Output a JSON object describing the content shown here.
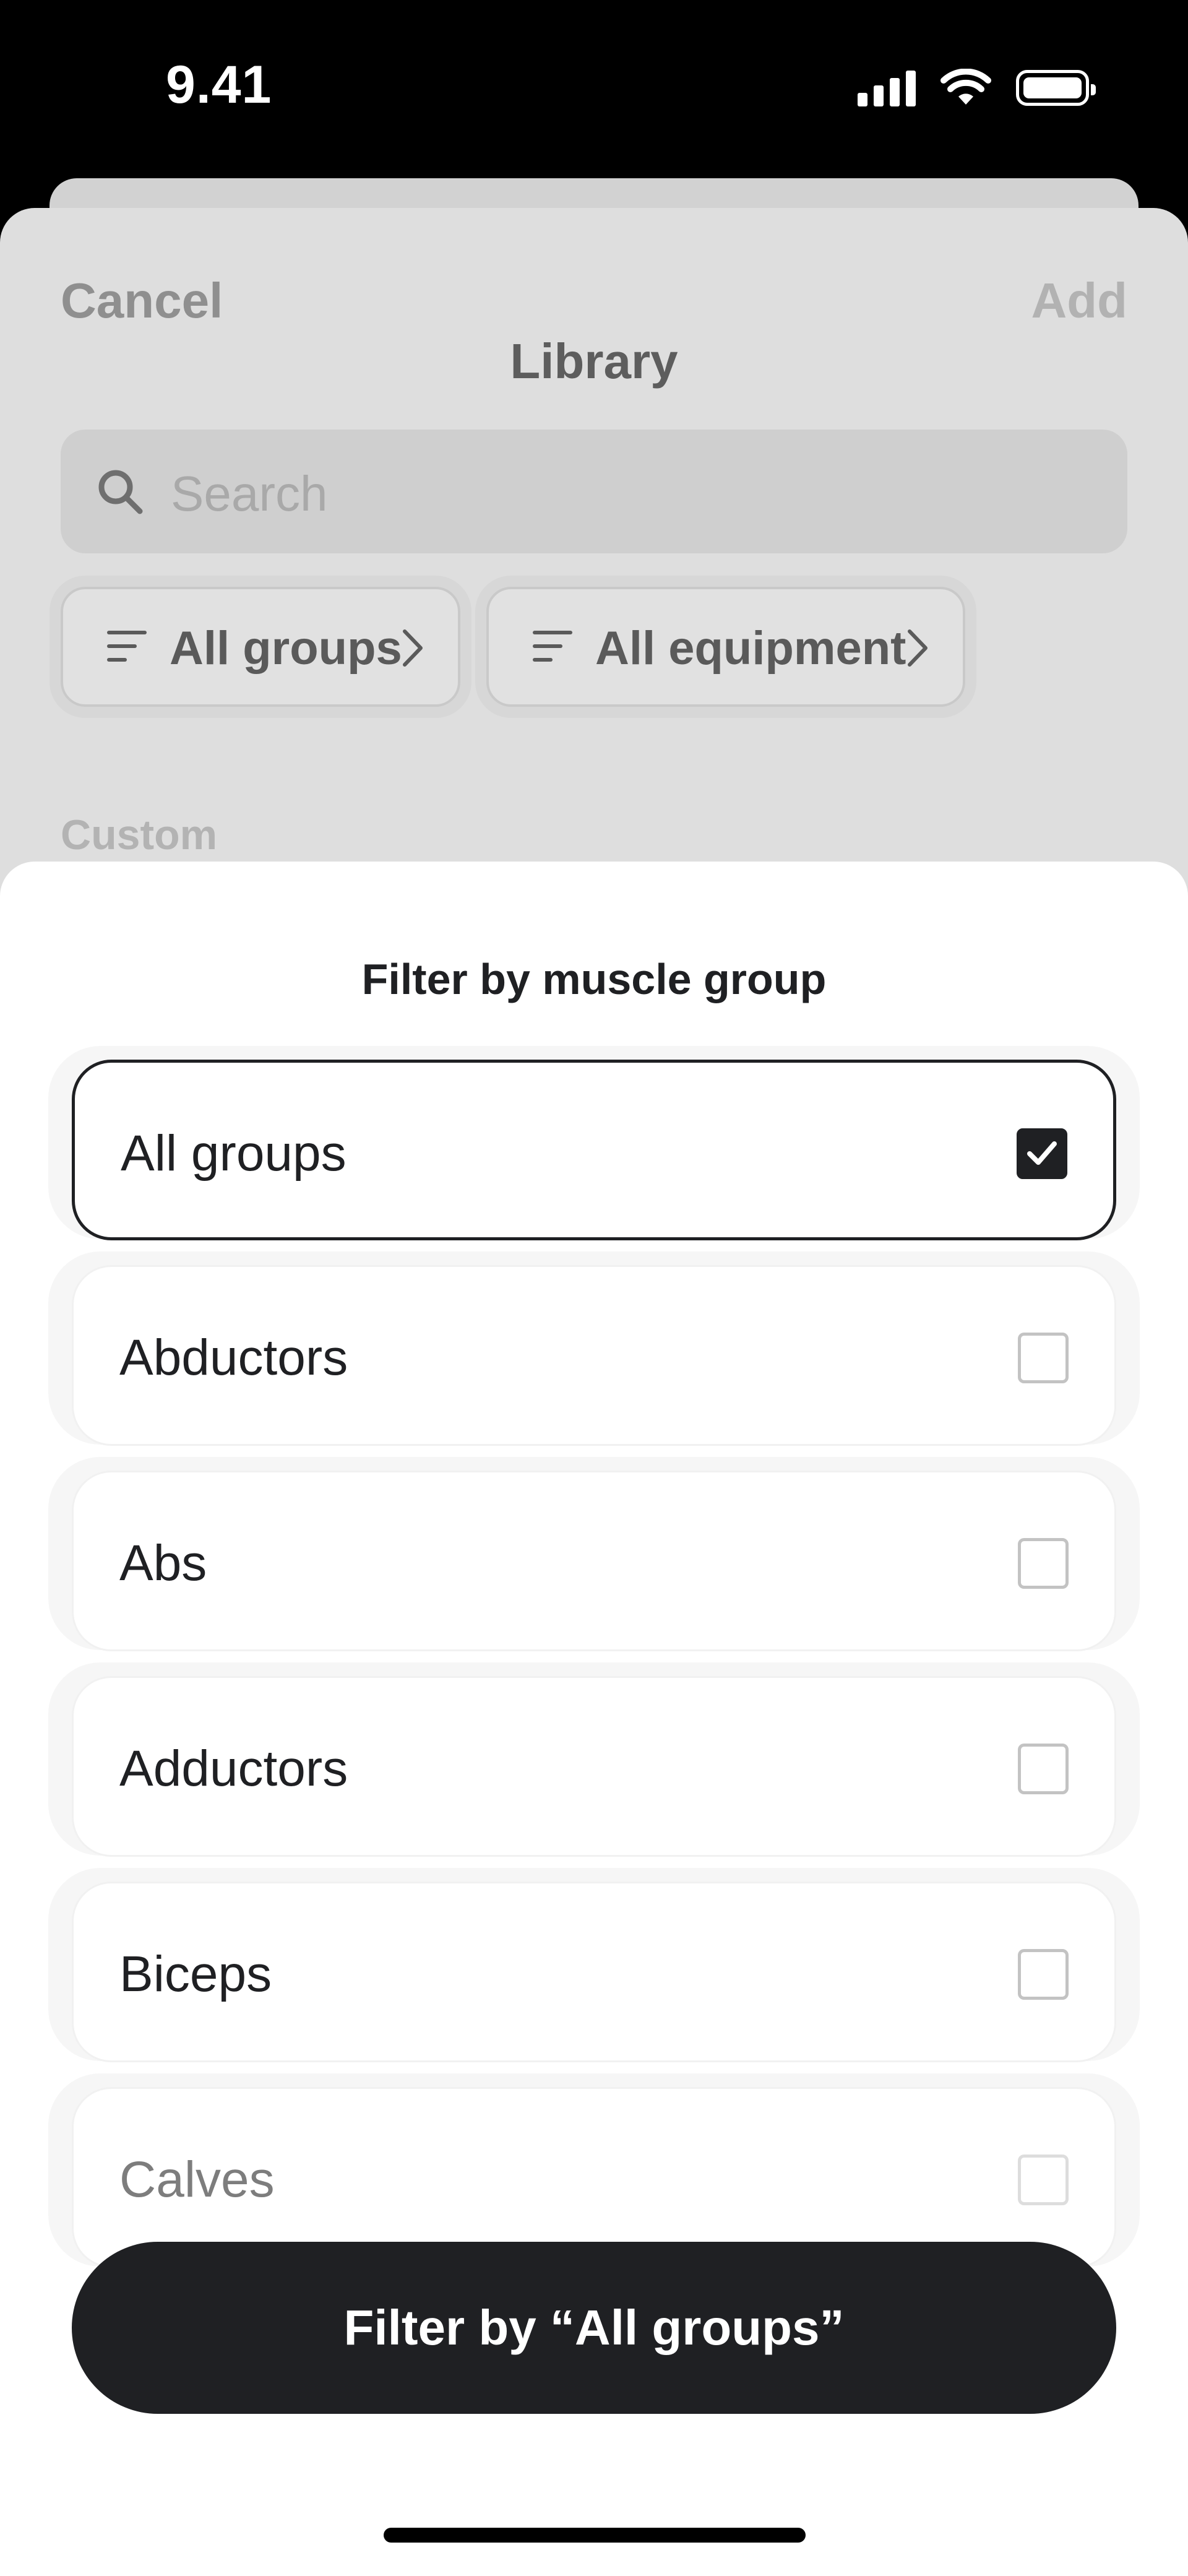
{
  "status_bar": {
    "time": "9.41",
    "icons": [
      "cellular-signal-icon",
      "wifi-icon",
      "battery-icon"
    ]
  },
  "library": {
    "cancel_label": "Cancel",
    "add_label": "Add",
    "title": "Library",
    "search_placeholder": "Search",
    "filters": {
      "groups_label": "All groups",
      "equipment_label": "All equipment"
    },
    "section_custom": "Custom"
  },
  "filter_sheet": {
    "title": "Filter by muscle group",
    "options": [
      {
        "label": "All groups",
        "checked": true
      },
      {
        "label": "Abductors",
        "checked": false
      },
      {
        "label": "Abs",
        "checked": false
      },
      {
        "label": "Adductors",
        "checked": false
      },
      {
        "label": "Biceps",
        "checked": false
      },
      {
        "label": "Calves",
        "checked": false
      }
    ],
    "apply_label": "Filter by “All groups”"
  },
  "colors": {
    "accent": "#1f2023",
    "sheet_background": "#ffffff",
    "dimmed_background": "#dedede"
  }
}
